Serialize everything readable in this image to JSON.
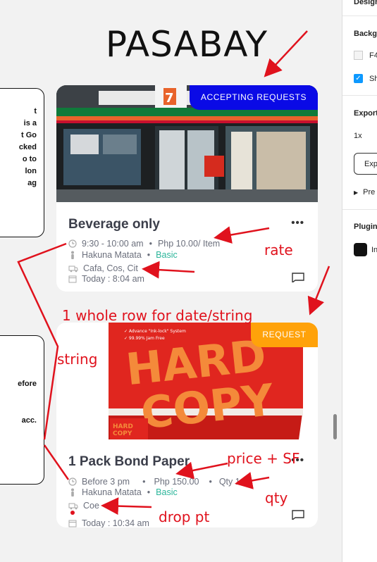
{
  "page_title": "PASABAY",
  "left_notes": {
    "top_lines": [
      "t",
      "is a",
      "t Go",
      "cked",
      "o to",
      "lon",
      "ag"
    ],
    "bottom_lines": [
      "efore",
      "acc."
    ]
  },
  "cards": [
    {
      "badge": "ACCEPTING REQUESTS",
      "badge_color": "#0a0ae6",
      "title": "Beverage only",
      "time": "9:30 - 10:00 am",
      "price": "Php 10.00/ Item",
      "courier": "Hakuna Matata",
      "tier": "Basic",
      "route": "Cafa, Cos, Cit",
      "date": "Today :  8:04 am"
    },
    {
      "badge": "REQUEST",
      "badge_color": "#ffa20a",
      "title": "1 Pack Bond Paper",
      "time": "Before 3 pm",
      "price": "Php 150.00",
      "qty": "Qty 1",
      "courier": "Hakuna Matata",
      "tier": "Basic",
      "route": "Coe",
      "date": "Today :  10:34 am"
    }
  ],
  "annotations": {
    "rate": "rate",
    "row_note": "1 whole row for date/string",
    "string": "string",
    "price_sf": "price + SF",
    "qty": "qty",
    "drop_pt": "drop pt"
  },
  "annotation_color": "#e0121d",
  "right_panel": {
    "design": "Design",
    "background": "Backgro",
    "bg_color": "F4",
    "show": "Sh",
    "export": "Export",
    "scale": "1x",
    "export_btn": "Exp",
    "preview": "Pre",
    "plugins": "Plugin",
    "plugin_item": "In"
  }
}
